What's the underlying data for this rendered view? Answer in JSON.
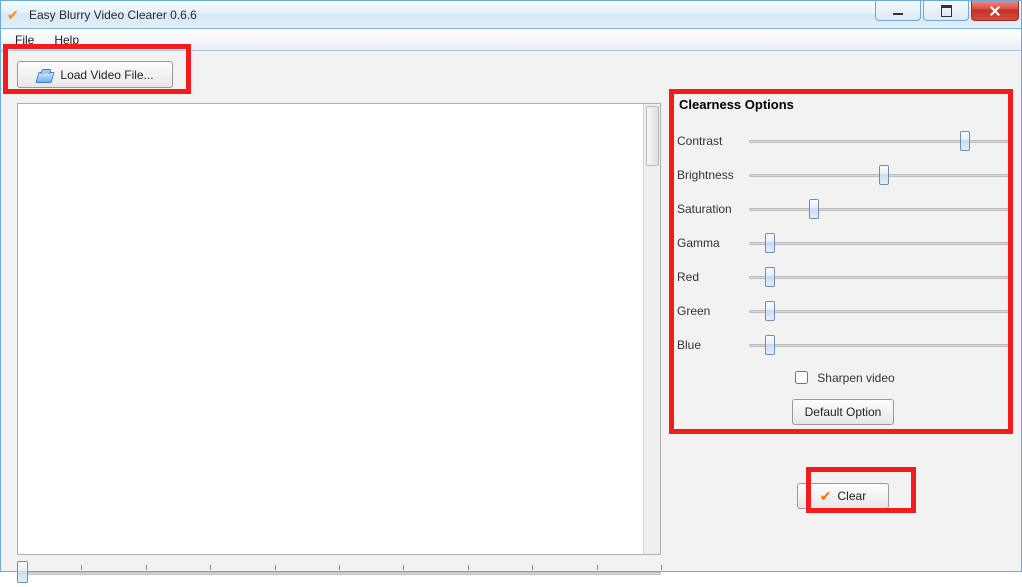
{
  "window": {
    "title": "Easy Blurry Video Clearer 0.6.6"
  },
  "menu": {
    "file": "File",
    "help": "Help"
  },
  "toolbar": {
    "load_label": "Load Video File..."
  },
  "timeline": {
    "value_pct": 0
  },
  "clearness": {
    "title": "Clearness Options",
    "sliders": [
      {
        "label": "Contrast",
        "value_pct": 83
      },
      {
        "label": "Brightness",
        "value_pct": 52
      },
      {
        "label": "Saturation",
        "value_pct": 25
      },
      {
        "label": "Gamma",
        "value_pct": 8
      },
      {
        "label": "Red",
        "value_pct": 8
      },
      {
        "label": "Green",
        "value_pct": 8
      },
      {
        "label": "Blue",
        "value_pct": 8
      }
    ],
    "sharpen_label": "Sharpen video",
    "sharpen_checked": false,
    "default_label": "Default Option"
  },
  "actions": {
    "clear_label": "Clear"
  }
}
